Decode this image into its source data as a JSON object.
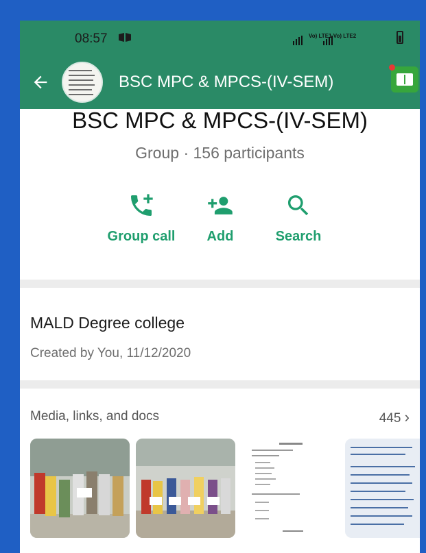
{
  "status": {
    "time": "08:57",
    "network": "Vo) LTE1 Vo) LTE2"
  },
  "toolbar": {
    "title": "BSC MPC & MPCS-(IV-SEM)"
  },
  "group": {
    "name": "BSC MPC & MPCS-(IV-SEM)",
    "subtitle": "Group · 156 participants",
    "description": "MALD Degree college",
    "created": "Created by You, 11/12/2020"
  },
  "actions": [
    {
      "label": "Group call",
      "icon": "add-call-icon"
    },
    {
      "label": "Add",
      "icon": "add-person-icon"
    },
    {
      "label": "Search",
      "icon": "search-icon"
    }
  ],
  "media": {
    "label": "Media, links, and docs",
    "count": "445",
    "chevron": "›"
  },
  "colors": {
    "header": "#2a8a66",
    "accent": "#1f9e6e",
    "frame": "#1f5fc4"
  }
}
